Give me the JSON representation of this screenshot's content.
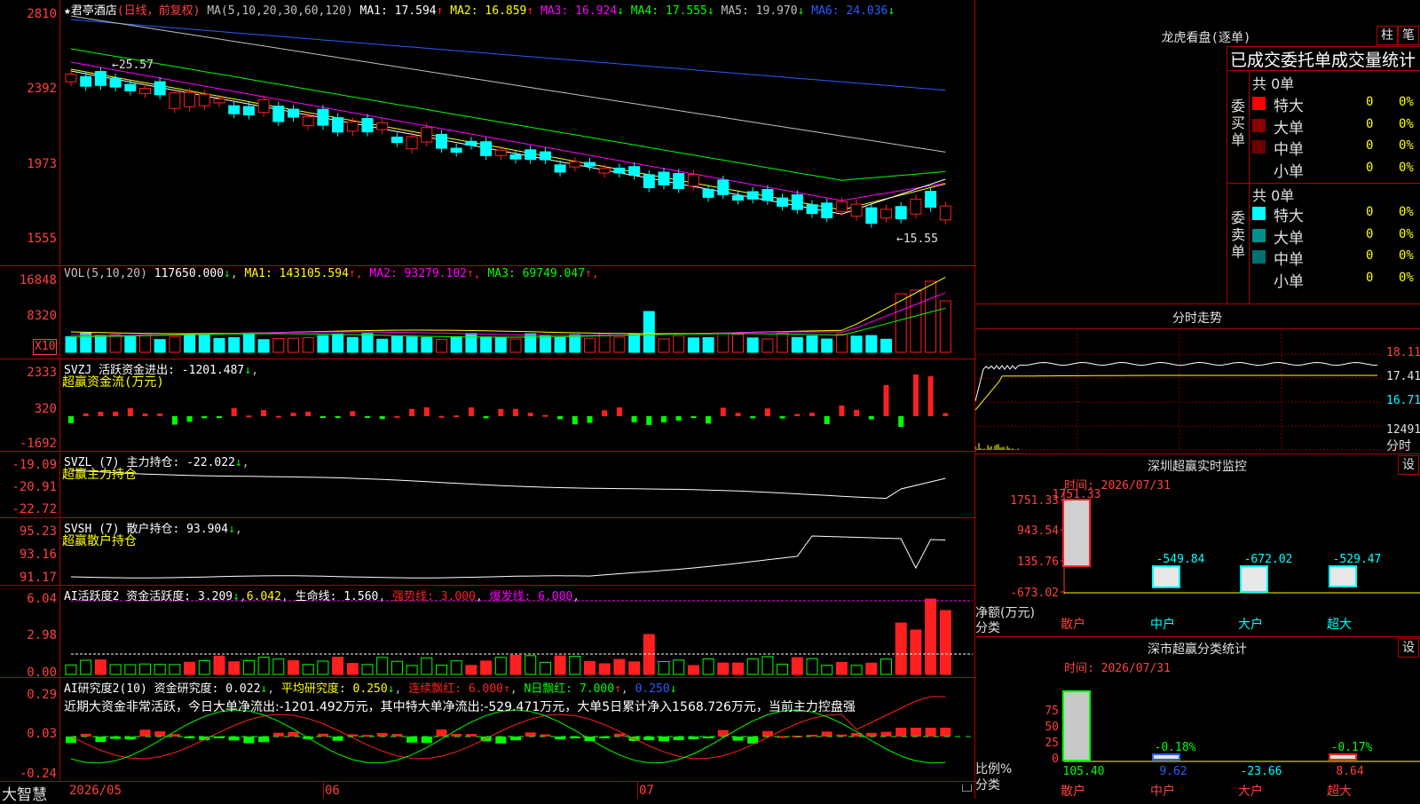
{
  "stock": {
    "name": "君亭酒店",
    "period": "(日线，前复权)",
    "ma_label": "MA(5,10,20,30,60,120)",
    "ma_values": [
      {
        "label": "MA1:",
        "value": "17.594",
        "arrow": "↑",
        "color": "#ffffff"
      },
      {
        "label": "MA2:",
        "value": "16.859",
        "arrow": "↑",
        "color": "#ffff00"
      },
      {
        "label": "MA3:",
        "value": "16.924",
        "arrow": "↓",
        "color": "#ff00ff"
      },
      {
        "label": "MA4:",
        "value": "17.555",
        "arrow": "↓",
        "color": "#00ff00"
      },
      {
        "label": "MA5:",
        "value": "19.970",
        "arrow": "↓",
        "color": "#c0c0c0"
      },
      {
        "label": "MA6:",
        "value": "24.036",
        "arrow": "↓",
        "color": "#2a5cff"
      }
    ],
    "high_label": "25.57",
    "low_label": "15.55"
  },
  "price_axis": [
    "2810",
    "2392",
    "1973",
    "1555"
  ],
  "vol": {
    "label": "VOL(5,10,20)",
    "value": "117650.000",
    "value_arrow": "↓",
    "ma": [
      {
        "label": "MA1:",
        "value": "143105.594",
        "arrow": "↑",
        "color": "#ffff00"
      },
      {
        "label": "MA2:",
        "value": "93279.102",
        "arrow": "↑",
        "color": "#ff00ff"
      },
      {
        "label": "MA3:",
        "value": "69749.047",
        "arrow": "↑",
        "color": "#00ff00"
      }
    ],
    "axis": [
      "16848",
      "8320"
    ],
    "unit": "X10"
  },
  "svzj": {
    "label": "SVZJ 活跃资金进出:",
    "value": "-1201.487",
    "arrow": "↓",
    "sub": "超赢资金流(万元)",
    "axis": [
      "2333",
      "320",
      "-1692"
    ]
  },
  "svzl": {
    "label": "SVZL (7) 主力持仓:",
    "value": "-22.022",
    "arrow": "↓",
    "sub": "超赢主力持仓",
    "axis": [
      "-19.09",
      "-20.91",
      "-22.72"
    ]
  },
  "svsh": {
    "label": "SVSH (7) 散户持仓:",
    "value": "93.904",
    "arrow": "↓",
    "sub": "超赢散户持仓",
    "axis": [
      "95.23",
      "93.16",
      "91.17"
    ]
  },
  "ai1": {
    "label": "AI活跃度2 资金活跃度:",
    "value": "3.209",
    "value_arrow": "↓",
    "v2": "6.042",
    "life_label": "生命线:",
    "life": "1.560",
    "strong": "强势线: 3.000",
    "burst": "爆发线: 6.000",
    "axis": [
      "6.04",
      "2.98",
      "0.00"
    ]
  },
  "ai2": {
    "label": "AI研究度2(10) 资金研究度:",
    "value": "0.022",
    "arrow1": "↓",
    "avg": "平均研究度: 0.250",
    "arrow2": "↓",
    "red": "连续飘红: 6.000",
    "arrow3": "↑",
    "nred": "N日飘红: 7.000",
    "arrow4": "↑",
    "last": "0.250",
    "arrow5": "↓",
    "commentary": "近期大资金非常活跃，今日大单净流出:-1201.492万元，其中特大单净流出:-529.471万元，大单5日累计净入1568.726万元，当前主力控盘强",
    "axis": [
      "0.29",
      "0.03",
      "-0.24"
    ]
  },
  "time_axis": [
    "2026/05",
    "06",
    "07"
  ],
  "brand": "大智慧",
  "dragon": {
    "title": "龙虎看盘(逐单)",
    "btn1": "柱",
    "btn2": "笔",
    "tabs": "已成交委托单成交量统计",
    "buy_vertical": "委买单",
    "sell_vertical": "委卖单",
    "buy_total": "共 0单",
    "sell_total": "共 0单",
    "buy_rows": [
      {
        "label": "特大",
        "count": "0",
        "pct": "0%",
        "color": "#ff0000"
      },
      {
        "label": "大单",
        "count": "0",
        "pct": "0%",
        "color": "#8b0000"
      },
      {
        "label": "中单",
        "count": "0",
        "pct": "0%",
        "color": "#6b0000"
      },
      {
        "label": "小单",
        "count": "0",
        "pct": "0%",
        "color": "#000000"
      }
    ],
    "sell_rows": [
      {
        "label": "特大",
        "count": "0",
        "pct": "0%",
        "color": "#00ffff"
      },
      {
        "label": "大单",
        "count": "0",
        "pct": "0%",
        "color": "#009090"
      },
      {
        "label": "中单",
        "count": "0",
        "pct": "0%",
        "color": "#007070"
      },
      {
        "label": "小单",
        "count": "0",
        "pct": "0%",
        "color": "#000000"
      }
    ]
  },
  "intraday": {
    "title": "分时走势",
    "axis": [
      "18.11",
      "17.41",
      "16.71"
    ],
    "vol": "12491",
    "vol_unit": "分时"
  },
  "sz_monitor": {
    "title": "深圳超赢实时监控",
    "btn": "设",
    "time": "时间: 2026/07/31",
    "axis": [
      "1751.33",
      "943.54",
      "135.76",
      "-673.02"
    ],
    "ylabel": "净额(万元)",
    "ylabel2": "分类",
    "bar_labels": [
      "1751.33",
      "-549.84",
      "-672.02",
      "-529.47"
    ],
    "categories": [
      "散户",
      "中户",
      "大户",
      "超大"
    ]
  },
  "sz_class": {
    "title": "深市超赢分类统计",
    "btn": "设",
    "time": "时间: 2026/07/31",
    "axis": [
      "75",
      "50",
      "25",
      "0"
    ],
    "ylabel": "比例%",
    "ylabel2": "分类",
    "top_labels": [
      "",
      "-0.18%",
      "",
      "-0.17%"
    ],
    "bottom_labels": [
      "105.40",
      "9.62",
      "-23.66",
      "8.64"
    ],
    "categories": [
      "散户",
      "中户",
      "大户",
      "超大"
    ]
  },
  "chart_data": {
    "type": "bar",
    "categories": [
      "散户",
      "中户",
      "大户",
      "超大"
    ],
    "values": [
      1751.33,
      -549.84,
      -672.02,
      -529.47
    ],
    "title": "深圳超赢实时监控",
    "ylabel": "净额(万元)",
    "ylim": [
      -673.02,
      1751.33
    ]
  }
}
